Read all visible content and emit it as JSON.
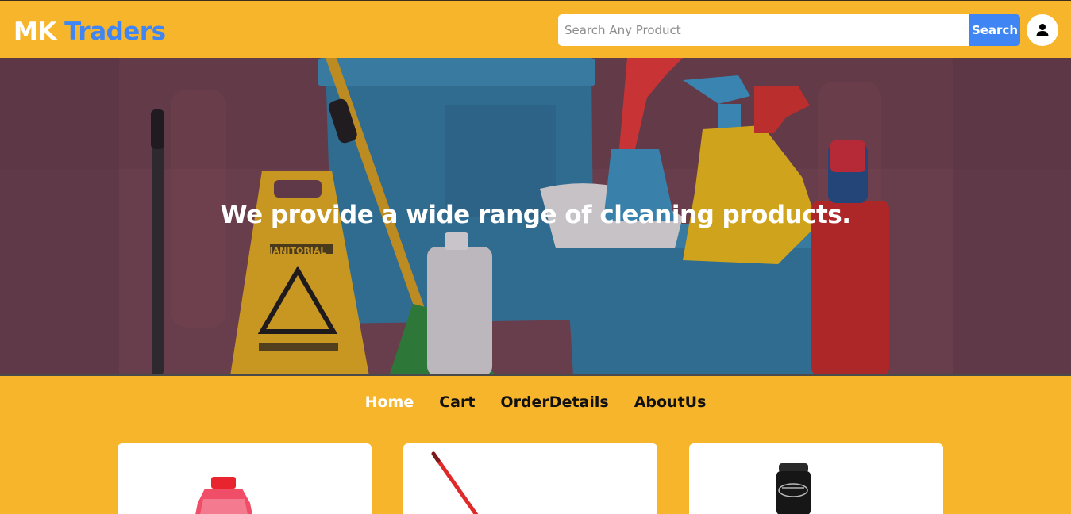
{
  "brand": {
    "part1": "MK",
    "part2": "Traders"
  },
  "search": {
    "placeholder": "Search Any Product",
    "value": "",
    "button_label": "Search"
  },
  "hero": {
    "tagline": "We provide a wide range of cleaning products."
  },
  "nav": {
    "items": [
      {
        "label": "Home",
        "active": true
      },
      {
        "label": "Cart",
        "active": false
      },
      {
        "label": "OrderDetails",
        "active": false
      },
      {
        "label": "AboutUs",
        "active": false
      }
    ]
  },
  "hero_sign_text": "JANITORIAL",
  "products": [
    {
      "image": "red-bottle"
    },
    {
      "image": "red-mop-handle"
    },
    {
      "image": "black-spray-can"
    }
  ],
  "colors": {
    "background": "#f7b52c",
    "accent": "#3f86f4",
    "card": "#ffffff"
  }
}
